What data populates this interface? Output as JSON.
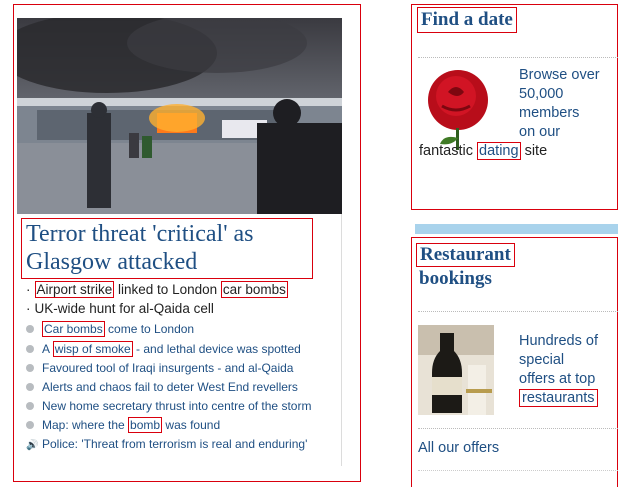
{
  "left": {
    "headline_line1": "Terror threat 'critical' as",
    "headline_line2": "Glasgow attacked",
    "sub_bullets": [
      {
        "prefix": "",
        "hl1": "Airport strike",
        "mid": " linked to London ",
        "hl2": "car bombs"
      },
      {
        "text": "UK-wide hunt for al-Qaida cell"
      }
    ],
    "links": [
      {
        "pre": "",
        "hl": "Car bombs",
        "post": " come to London"
      },
      {
        "pre": "A ",
        "hl": "wisp of smoke",
        "post": " - and lethal device was spotted"
      },
      {
        "pre": "Favoured tool of Iraqi insurgents - and al-Qaida",
        "hl": "",
        "post": ""
      },
      {
        "pre": "Alerts and chaos fail to deter West End revellers",
        "hl": "",
        "post": ""
      },
      {
        "pre": "New home secretary thrust into centre of the storm",
        "hl": "",
        "post": ""
      },
      {
        "pre": "Map: where the ",
        "hl": "bomb",
        "post": " was found"
      },
      {
        "pre": "Police: 'Threat from terrorism is real and enduring'",
        "hl": "",
        "post": ""
      }
    ],
    "icons": {
      "bullet": "bullet-dot-icon",
      "audio": "speaker-icon"
    }
  },
  "date": {
    "title": "Find a date",
    "l1": "Browse over",
    "l2": "50,000",
    "l3": "members",
    "l4": "on our",
    "l5_pre": "fantastic ",
    "l5_hl": "dating",
    "l5_post": " site"
  },
  "restaurant": {
    "title_l1": "Restaurant",
    "title_l2": "bookings",
    "t1": "Hundreds of",
    "t2": "special",
    "t3": "offers at top",
    "t4": "restaurants",
    "all_offers": "All our offers"
  },
  "colors": {
    "link_blue": "#1f4f83",
    "highlight_red": "#d9000d",
    "bar_blue": "#a9d3ec"
  }
}
